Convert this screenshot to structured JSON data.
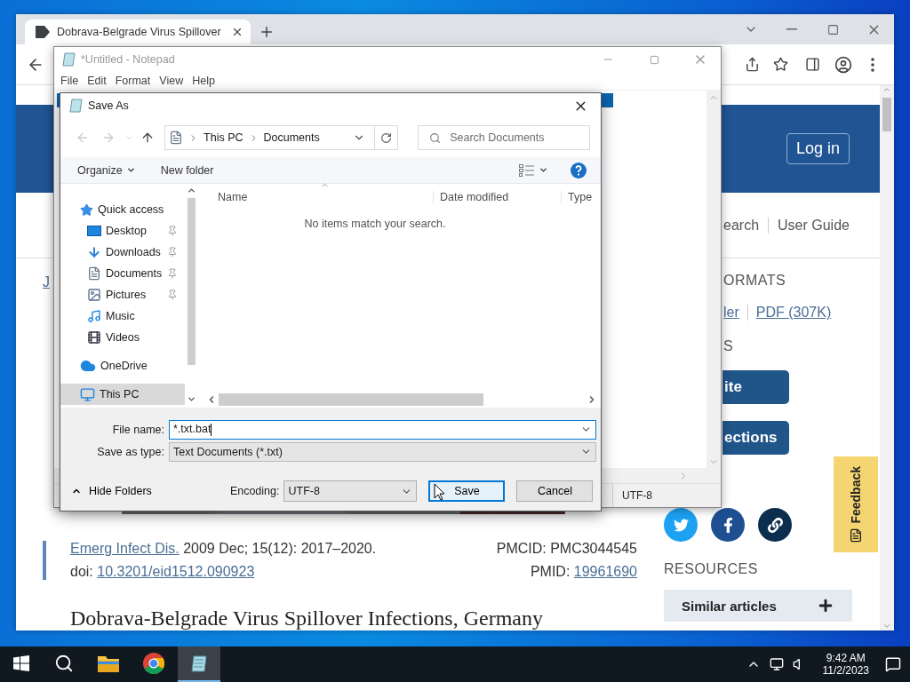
{
  "browser": {
    "tab_title": "Dobrava-Belgrade Virus Spillover",
    "page": {
      "login_button": "Log in",
      "nav_links": [
        "earch",
        "User Guide"
      ],
      "left_link": "J",
      "formats_heading": "ORMATS",
      "format_links": [
        "ler",
        "PDF (307K)"
      ],
      "actions_heading": "S",
      "action_buttons": [
        "ite",
        "ections"
      ],
      "feedback": "Feedback",
      "citation": {
        "journal": "Emerg Infect Dis.",
        "issue": "2009 Dec; 15(12): 2017–2020.",
        "pmcid": "PMCID: PMC3044545",
        "doi_label": "doi:",
        "doi": "10.3201/eid1512.090923",
        "pmid_label": "PMID:",
        "pmid": "19961690"
      },
      "resources_heading": "RESOURCES",
      "resources": [
        "Similar articles"
      ],
      "article_title": "Dobrava-Belgrade Virus Spillover Infections, Germany"
    }
  },
  "notepad": {
    "title": "*Untitled - Notepad",
    "menu": [
      "File",
      "Edit",
      "Format",
      "View",
      "Help"
    ],
    "encoding": "UTF-8"
  },
  "save_dialog": {
    "title": "Save As",
    "breadcrumb": [
      "This PC",
      "Documents"
    ],
    "search_placeholder": "Search Documents",
    "toolbar": [
      "Organize",
      "New folder"
    ],
    "nav": [
      {
        "label": "Quick access",
        "kind": "quick",
        "selected": false,
        "children": [
          {
            "label": "Desktop",
            "kind": "desktop",
            "pinned": true,
            "selected": false
          },
          {
            "label": "Downloads",
            "kind": "downloads",
            "pinned": true,
            "selected": false
          },
          {
            "label": "Documents",
            "kind": "documents",
            "pinned": true,
            "selected": false
          },
          {
            "label": "Pictures",
            "kind": "pictures",
            "pinned": true,
            "selected": false
          },
          {
            "label": "Music",
            "kind": "music",
            "pinned": false,
            "selected": false
          },
          {
            "label": "Videos",
            "kind": "videos",
            "pinned": false,
            "selected": false
          }
        ]
      },
      {
        "label": "OneDrive",
        "kind": "cloud",
        "selected": false
      },
      {
        "label": "This PC",
        "kind": "pc",
        "selected": true
      }
    ],
    "columns": [
      "Name",
      "Date modified",
      "Type"
    ],
    "empty_message": "No items match your search.",
    "file_name_label": "File name:",
    "file_name": "*.txt.bat",
    "save_type_label": "Save as type:",
    "save_type": "Text Documents (*.txt)",
    "hide_folders": "Hide Folders",
    "encoding_label": "Encoding:",
    "encoding": "UTF-8",
    "buttons": [
      {
        "label": "Save",
        "kind": "primary"
      },
      {
        "label": "Cancel",
        "kind": "normal"
      }
    ]
  },
  "taskbar": {
    "apps": [
      {
        "kind": "explorer",
        "selected": false
      },
      {
        "kind": "chrome",
        "selected": false
      },
      {
        "kind": "notepad",
        "selected": true
      }
    ],
    "time": "9:42 AM",
    "date": "11/2/2023"
  }
}
